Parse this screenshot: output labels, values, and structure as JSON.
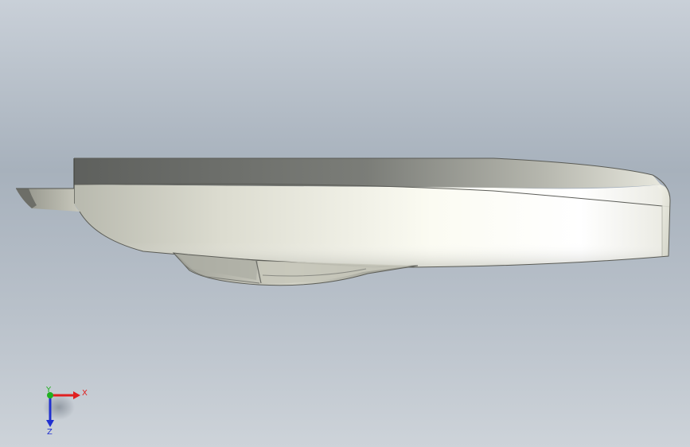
{
  "viewport": {
    "background_top": "#c9d0d8",
    "background_mid": "#a7b1bc",
    "background_bottom": "#cdd3d9"
  },
  "model": {
    "body_color_light": "#fbfbf4",
    "body_color_mid": "#e8e7dc",
    "body_color_dark": "#a4a59c",
    "deck_color": "#6a6c69"
  },
  "triad": {
    "x_label": "X",
    "y_label": "Y",
    "z_label": "Z",
    "x_color": "#e02020",
    "y_color": "#20b020",
    "z_color": "#2030d0"
  }
}
